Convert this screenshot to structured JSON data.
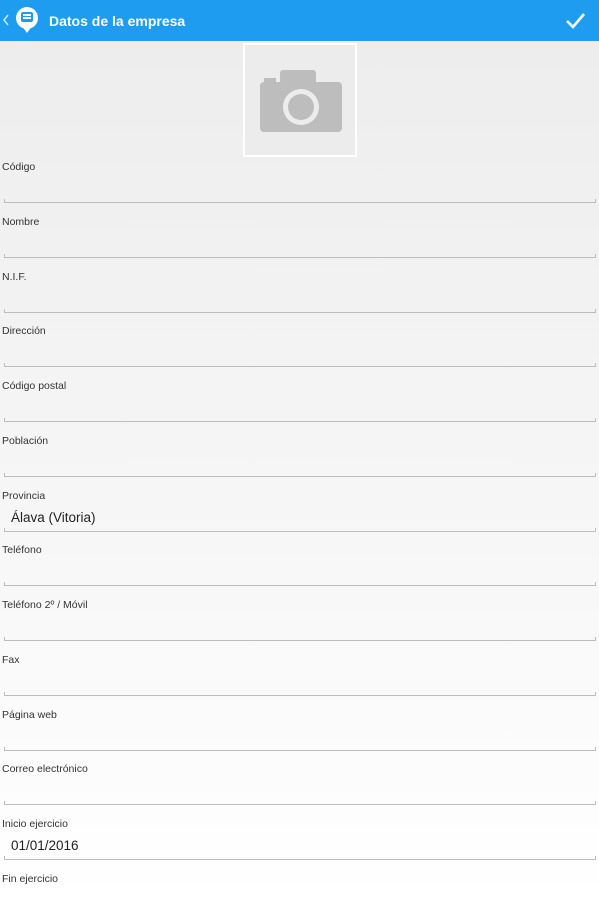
{
  "appbar": {
    "title": "Datos de la empresa",
    "back_icon": "chevron-left-icon",
    "logo_icon": "app-logo-icon",
    "confirm_icon": "checkmark-icon",
    "color": "#1e9cf0"
  },
  "photo": {
    "icon": "camera-icon"
  },
  "fields": [
    {
      "label": "Código",
      "value": ""
    },
    {
      "label": "Nombre",
      "value": ""
    },
    {
      "label": "N.I.F.",
      "value": ""
    },
    {
      "label": "Dirección",
      "value": ""
    },
    {
      "label": "Código postal",
      "value": ""
    },
    {
      "label": "Población",
      "value": ""
    },
    {
      "label": "Provincia",
      "value": "Álava (Vitoria)"
    },
    {
      "label": "Teléfono",
      "value": ""
    },
    {
      "label": "Teléfono 2º / Móvil",
      "value": ""
    },
    {
      "label": "Fax",
      "value": ""
    },
    {
      "label": "Página web",
      "value": ""
    },
    {
      "label": "Correo electrónico",
      "value": ""
    },
    {
      "label": "Inicio ejercicio",
      "value": "01/01/2016"
    },
    {
      "label": "Fin ejercicio",
      "value": ""
    }
  ]
}
